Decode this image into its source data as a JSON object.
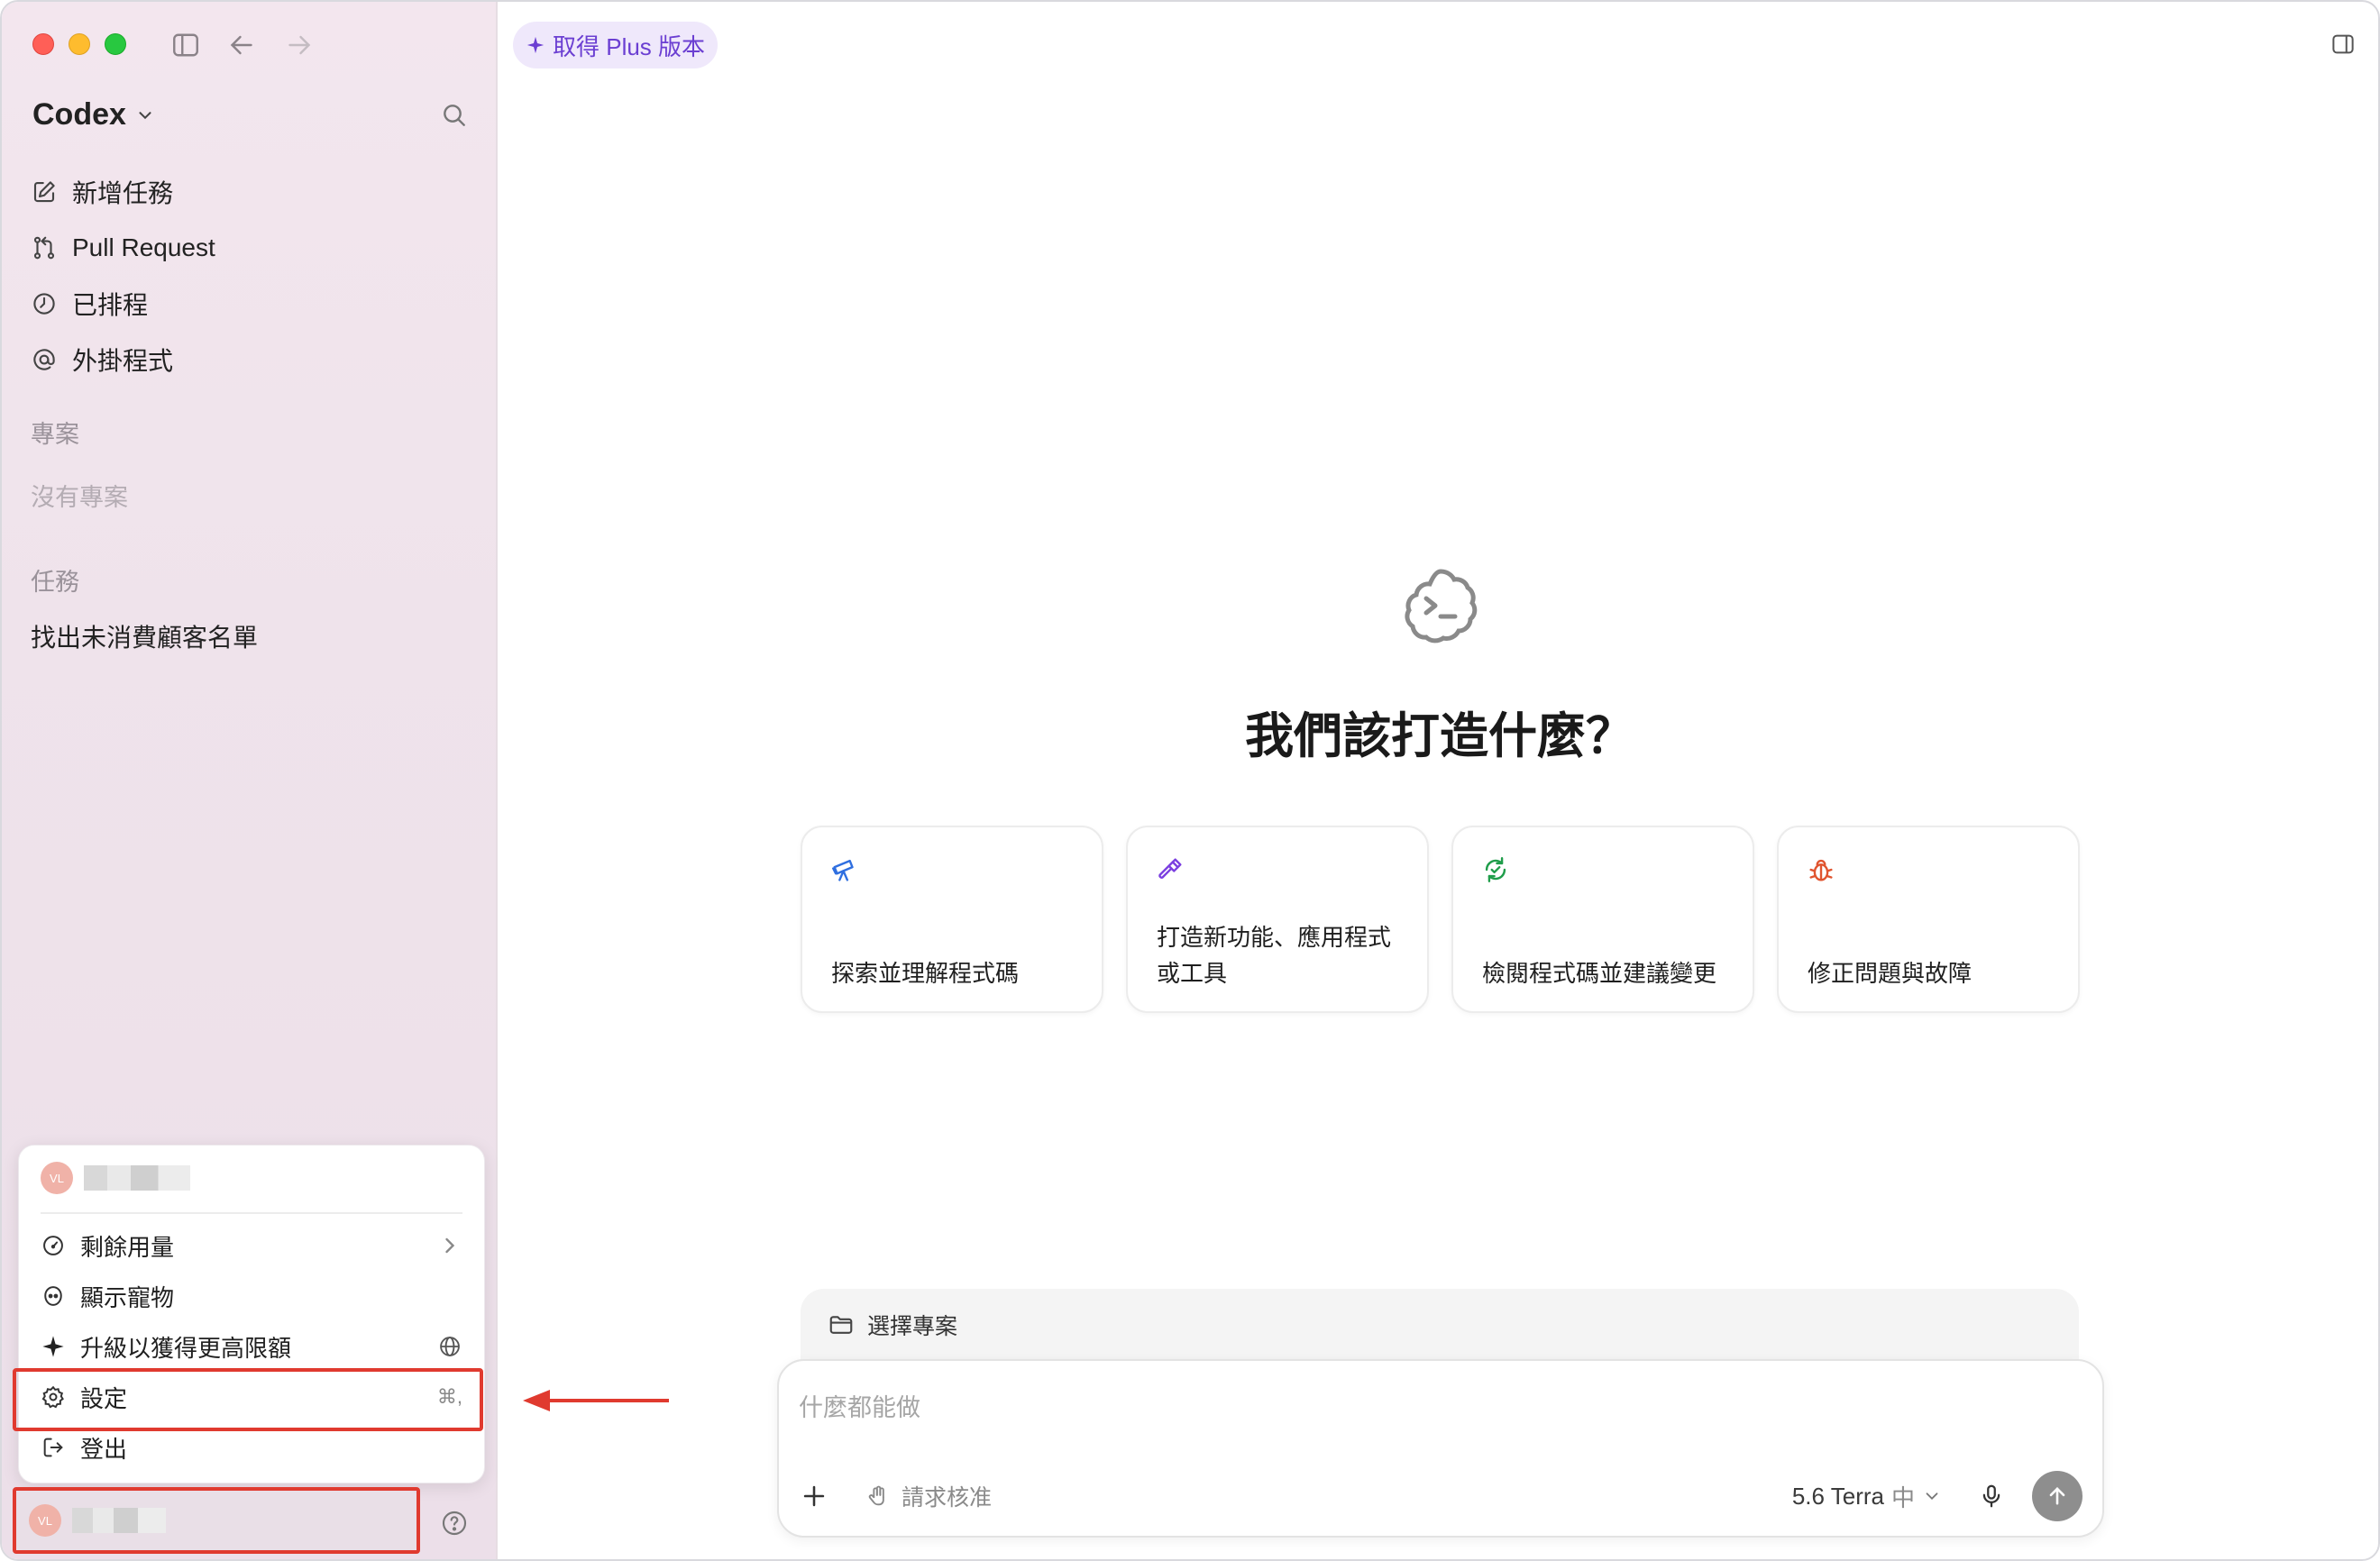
{
  "window": {
    "title": "Codex"
  },
  "sidebar": {
    "brand": "Codex",
    "nav": [
      {
        "label": "新增任務",
        "icon": "edit-icon"
      },
      {
        "label": "Pull Request",
        "icon": "git-pull-request-icon"
      },
      {
        "label": "已排程",
        "icon": "clock-icon"
      },
      {
        "label": "外掛程式",
        "icon": "at-icon"
      }
    ],
    "projects_label": "專案",
    "projects_empty": "沒有專案",
    "tasks_label": "任務",
    "tasks": [
      "找出未消費顧客名單"
    ]
  },
  "account_menu": {
    "avatar_initials": "VL",
    "items": [
      {
        "label": "剩餘用量",
        "icon": "gauge-icon",
        "right": "chevron-right-icon"
      },
      {
        "label": "顯示寵物",
        "icon": "pet-icon",
        "right": ""
      },
      {
        "label": "升級以獲得更高限額",
        "icon": "sparkle-icon",
        "right": "globe-icon"
      },
      {
        "label": "設定",
        "icon": "gear-icon",
        "right": "⌘,"
      },
      {
        "label": "登出",
        "icon": "logout-icon",
        "right": ""
      }
    ]
  },
  "bottom_account": {
    "avatar_initials": "VL"
  },
  "header": {
    "upgrade_label": "取得 Plus 版本"
  },
  "main": {
    "headline": "我們該打造什麼？",
    "cards": [
      {
        "label": "探索並理解程式碼",
        "icon": "telescope-icon",
        "color": "#2f6fe0"
      },
      {
        "label": "打造新功能、應用程式或工具",
        "icon": "hammer-icon",
        "color": "#7b3fe0"
      },
      {
        "label": "檢閱程式碼並建議變更",
        "icon": "refresh-review-icon",
        "color": "#1f9d4a"
      },
      {
        "label": "修正問題與故障",
        "icon": "bug-icon",
        "color": "#e0542f"
      }
    ]
  },
  "composer": {
    "project_label": "選擇專案",
    "placeholder": "什麼都能做",
    "permission_label": "請求核准",
    "model_label": "5.6 Terra",
    "model_effort": "中"
  },
  "colors": {
    "accent": "#6b3fd2",
    "highlight": "#e03a2f"
  }
}
